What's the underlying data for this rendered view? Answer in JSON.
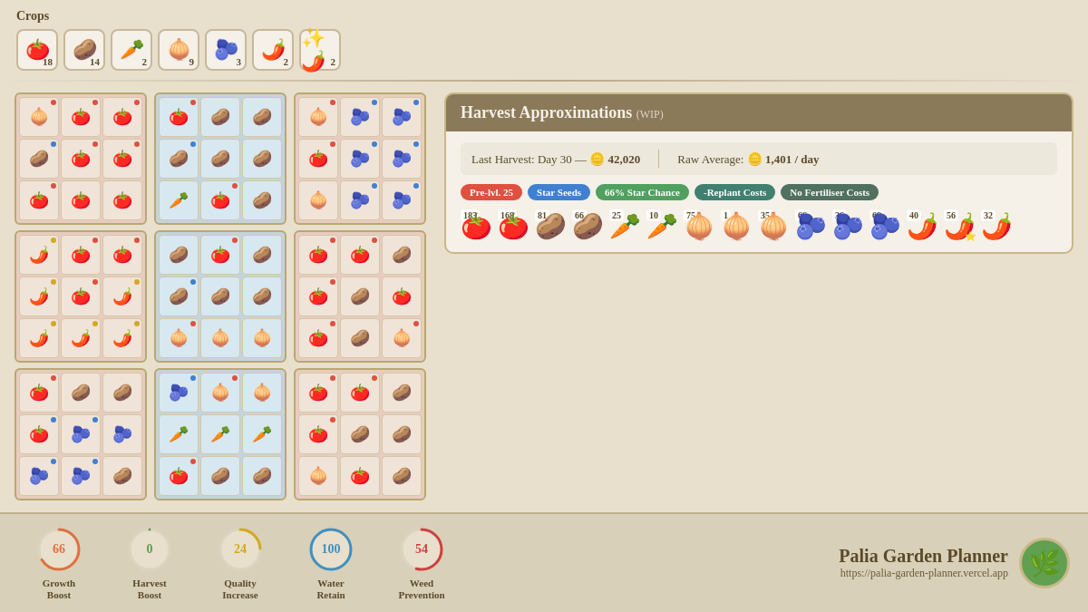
{
  "page": {
    "title": "Palia Garden Planner",
    "url": "https://palia-garden-planner.vercel.app"
  },
  "crops_label": "Crops",
  "crops": [
    {
      "emoji": "🍅",
      "count": 18
    },
    {
      "emoji": "🥔",
      "count": 14
    },
    {
      "emoji": "🥕",
      "count": 2
    },
    {
      "emoji": "🧅",
      "count": 9
    },
    {
      "emoji": "🫐",
      "count": 3
    },
    {
      "emoji": "🌶️",
      "count": 2
    },
    {
      "emoji": "✨🌶️",
      "count": 2
    }
  ],
  "harvest": {
    "title": "Harvest Approximations",
    "wip_label": "(WIP)",
    "last_harvest_label": "Last Harvest: Day 30 —",
    "last_harvest_gold": "42,020",
    "raw_avg_label": "Raw Average:",
    "raw_avg_gold": "1,401 / day",
    "tags": [
      {
        "label": "Pre-lvl. 25",
        "class": "tag-red"
      },
      {
        "label": "Star Seeds",
        "class": "tag-blue"
      },
      {
        "label": "66% Star Chance",
        "class": "tag-green"
      },
      {
        "label": "-Replant Costs",
        "class": "tag-teal"
      },
      {
        "label": "No Fertiliser Costs",
        "class": "tag-dark"
      }
    ],
    "items": [
      {
        "emoji": "🍅",
        "count": "183",
        "star": false
      },
      {
        "emoji": "🍅",
        "count": "168",
        "star": false
      },
      {
        "emoji": "🥔",
        "count": "81",
        "star": false
      },
      {
        "emoji": "🥔",
        "count": "66",
        "star": false
      },
      {
        "emoji": "🥕",
        "count": "25",
        "star": false
      },
      {
        "emoji": "🥕",
        "count": "10",
        "star": false
      },
      {
        "emoji": "🧅",
        "count": "75",
        "star": false
      },
      {
        "emoji": "🧅",
        "count": "1",
        "star": false
      },
      {
        "emoji": "🧅",
        "count": "35",
        "star": false
      },
      {
        "emoji": "🫐",
        "count": "66",
        "star": false
      },
      {
        "emoji": "🫐",
        "count": "36",
        "star": false
      },
      {
        "emoji": "🫐",
        "count": "68",
        "star": false
      },
      {
        "emoji": "🌶️",
        "count": "40",
        "star": false
      },
      {
        "emoji": "🌶️",
        "count": "56",
        "star": true
      },
      {
        "emoji": "🌶️",
        "count": "32",
        "star": false
      }
    ]
  },
  "stats": [
    {
      "label": "Growth\nBoost",
      "value": "66",
      "class": "orange",
      "icon": "⏩"
    },
    {
      "label": "Harvest\nBoost",
      "value": "0",
      "class": "green",
      "icon": "🌿"
    },
    {
      "label": "Quality\nIncrease",
      "value": "24",
      "class": "gold",
      "icon": "⭐"
    },
    {
      "label": "Water\nRetain",
      "value": "100",
      "class": "blue",
      "icon": "💧"
    },
    {
      "label": "Weed\nPrevention",
      "value": "54",
      "class": "red",
      "icon": "🌱"
    }
  ],
  "garden": {
    "rows": [
      {
        "plots": [
          {
            "bg": "pink",
            "cells": [
              {
                "emoji": "🧅",
                "dot": "red"
              },
              {
                "emoji": "🍅",
                "dot": "red"
              },
              {
                "emoji": "🍅",
                "dot": "red"
              },
              {
                "emoji": "🥔",
                "dot": "blue"
              },
              {
                "emoji": "🍅",
                "dot": "red"
              },
              {
                "emoji": "🍅",
                "dot": "red"
              },
              {
                "emoji": "🍅",
                "dot": "red"
              },
              {
                "emoji": "🍅",
                "dot": ""
              },
              {
                "emoji": "🍅",
                "dot": ""
              }
            ]
          },
          {
            "bg": "blue",
            "cells": [
              {
                "emoji": "🍅",
                "dot": "red"
              },
              {
                "emoji": "🥔",
                "dot": ""
              },
              {
                "emoji": "🥔",
                "dot": ""
              },
              {
                "emoji": "🥔",
                "dot": "blue"
              },
              {
                "emoji": "🥔",
                "dot": ""
              },
              {
                "emoji": "🥔",
                "dot": ""
              },
              {
                "emoji": "🥕",
                "dot": ""
              },
              {
                "emoji": "🍅",
                "dot": "red"
              },
              {
                "emoji": "🥔",
                "dot": ""
              }
            ]
          },
          {
            "bg": "pink",
            "cells": [
              {
                "emoji": "🧅",
                "dot": "red"
              },
              {
                "emoji": "🫐",
                "dot": "blue"
              },
              {
                "emoji": "🫐",
                "dot": "blue"
              },
              {
                "emoji": "🍅",
                "dot": "red"
              },
              {
                "emoji": "🫐",
                "dot": "blue"
              },
              {
                "emoji": "🫐",
                "dot": "blue"
              },
              {
                "emoji": "🧅",
                "dot": ""
              },
              {
                "emoji": "🫐",
                "dot": "blue"
              },
              {
                "emoji": "🫐",
                "dot": "blue"
              }
            ]
          }
        ]
      },
      {
        "plots": [
          {
            "bg": "pink",
            "cells": [
              {
                "emoji": "🌶️",
                "dot": "gold"
              },
              {
                "emoji": "🍅",
                "dot": "red"
              },
              {
                "emoji": "🍅",
                "dot": "red"
              },
              {
                "emoji": "🌶️",
                "dot": "gold"
              },
              {
                "emoji": "🍅",
                "dot": "red"
              },
              {
                "emoji": "🌶️",
                "dot": "gold"
              },
              {
                "emoji": "🌶️",
                "dot": "gold"
              },
              {
                "emoji": "🌶️",
                "dot": "gold"
              },
              {
                "emoji": "🌶️",
                "dot": "gold"
              }
            ]
          },
          {
            "bg": "blue",
            "cells": [
              {
                "emoji": "🥔",
                "dot": ""
              },
              {
                "emoji": "🍅",
                "dot": "red"
              },
              {
                "emoji": "🥔",
                "dot": ""
              },
              {
                "emoji": "🥔",
                "dot": "blue"
              },
              {
                "emoji": "🥔",
                "dot": ""
              },
              {
                "emoji": "🥔",
                "dot": ""
              },
              {
                "emoji": "🧅",
                "dot": "red"
              },
              {
                "emoji": "🧅",
                "dot": ""
              },
              {
                "emoji": "🧅",
                "dot": ""
              }
            ]
          },
          {
            "bg": "pink",
            "cells": [
              {
                "emoji": "🍅",
                "dot": "red"
              },
              {
                "emoji": "🍅",
                "dot": "red"
              },
              {
                "emoji": "🥔",
                "dot": ""
              },
              {
                "emoji": "🍅",
                "dot": "red"
              },
              {
                "emoji": "🥔",
                "dot": ""
              },
              {
                "emoji": "🍅",
                "dot": ""
              },
              {
                "emoji": "🍅",
                "dot": "red"
              },
              {
                "emoji": "🥔",
                "dot": ""
              },
              {
                "emoji": "🧅",
                "dot": "red"
              }
            ]
          }
        ]
      },
      {
        "plots": [
          {
            "bg": "pink",
            "cells": [
              {
                "emoji": "🍅",
                "dot": "red"
              },
              {
                "emoji": "🥔",
                "dot": ""
              },
              {
                "emoji": "🥔",
                "dot": ""
              },
              {
                "emoji": "🍅",
                "dot": "blue"
              },
              {
                "emoji": "🫐",
                "dot": "blue"
              },
              {
                "emoji": "🫐",
                "dot": ""
              },
              {
                "emoji": "🫐",
                "dot": "blue"
              },
              {
                "emoji": "🫐",
                "dot": "blue"
              },
              {
                "emoji": "🥔",
                "dot": ""
              }
            ]
          },
          {
            "bg": "blue",
            "cells": [
              {
                "emoji": "🫐",
                "dot": "blue"
              },
              {
                "emoji": "🧅",
                "dot": "red"
              },
              {
                "emoji": "🧅",
                "dot": ""
              },
              {
                "emoji": "🥕",
                "dot": ""
              },
              {
                "emoji": "🥕",
                "dot": ""
              },
              {
                "emoji": "🥕",
                "dot": ""
              },
              {
                "emoji": "🍅",
                "dot": "red"
              },
              {
                "emoji": "🥔",
                "dot": ""
              },
              {
                "emoji": "🥔",
                "dot": ""
              }
            ]
          },
          {
            "bg": "pink",
            "cells": [
              {
                "emoji": "🍅",
                "dot": "red"
              },
              {
                "emoji": "🍅",
                "dot": "red"
              },
              {
                "emoji": "🥔",
                "dot": ""
              },
              {
                "emoji": "🍅",
                "dot": "red"
              },
              {
                "emoji": "🥔",
                "dot": ""
              },
              {
                "emoji": "🥔",
                "dot": ""
              },
              {
                "emoji": "🧅",
                "dot": ""
              },
              {
                "emoji": "🍅",
                "dot": ""
              },
              {
                "emoji": "🥔",
                "dot": ""
              }
            ]
          }
        ]
      }
    ]
  }
}
